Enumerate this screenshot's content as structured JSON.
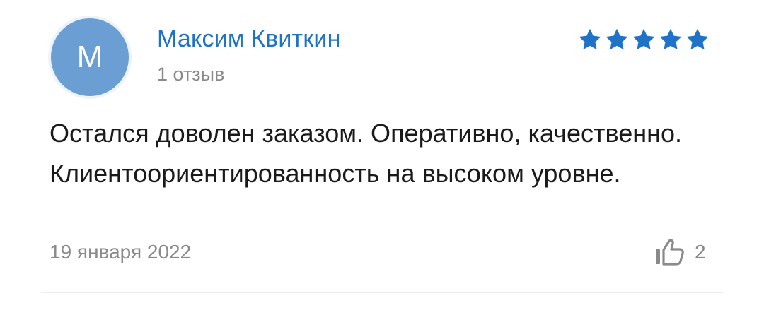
{
  "review": {
    "author": {
      "initial": "M",
      "name": "Максим Квиткин",
      "reviews_count": "1 отзыв"
    },
    "rating": 5,
    "rating_max": 5,
    "star_color": "#1e73c8",
    "text": "Остался доволен заказом. Оперативно, качественно. Клиентоориентированность на высоком уровне.",
    "date": "19 января 2022",
    "likes": "2",
    "icons": {
      "star": "star-icon",
      "like": "thumbs-up-icon"
    }
  }
}
